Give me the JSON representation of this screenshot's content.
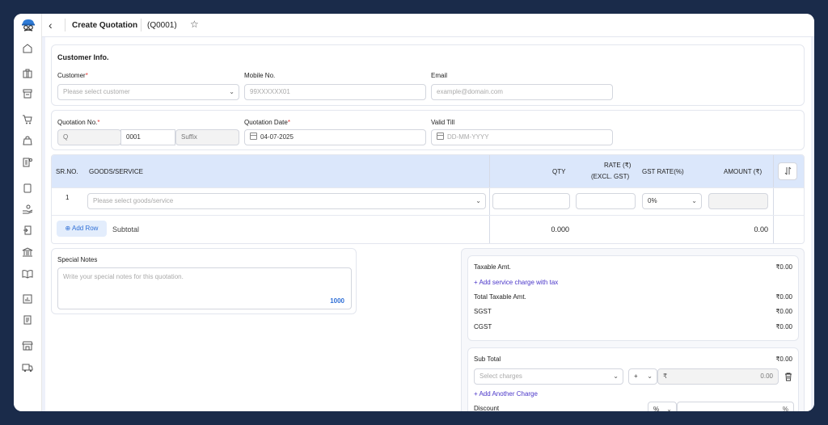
{
  "header": {
    "title": "Create Quotation",
    "code": "(Q0001)"
  },
  "customer_info": {
    "title": "Customer Info.",
    "customer": {
      "label": "Customer",
      "placeholder": "Please select customer"
    },
    "mobile": {
      "label": "Mobile No.",
      "placeholder": "99XXXXXX01"
    },
    "email": {
      "label": "Email",
      "placeholder": "example@domain.com"
    }
  },
  "quotation": {
    "number_label": "Quotation No.",
    "prefix": "Q",
    "number": "0001",
    "suffix_placeholder": "Suffix",
    "date_label": "Quotation Date",
    "date_value": "04-07-2025",
    "valid_till_label": "Valid Till",
    "valid_till_placeholder": "DD-MM-YYYY"
  },
  "table": {
    "headers": {
      "sr": "SR.NO.",
      "goods": "GOODS/SERVICE",
      "qty": "QTY",
      "rate": "RATE (₹)",
      "rate_sub": "(EXCL. GST)",
      "gst": "GST RATE(%)",
      "amount": "AMOUNT (₹)"
    },
    "rows": [
      {
        "sr": "1",
        "goods_placeholder": "Please select goods/service",
        "gst": "0%"
      }
    ],
    "add_row": "Add Row",
    "subtotal_label": "Subtotal",
    "subtotal_qty": "0.000",
    "subtotal_amount": "0.00"
  },
  "notes": {
    "label": "Special Notes",
    "placeholder": "Write your special notes for this quotation.",
    "remaining": "1000"
  },
  "summary": {
    "taxable_label": "Taxable Amt.",
    "taxable_value": "₹0.00",
    "add_service_charge": "Add service charge with tax",
    "total_taxable_label": "Total Taxable Amt.",
    "total_taxable_value": "₹0.00",
    "sgst_label": "SGST",
    "sgst_value": "₹0.00",
    "cgst_label": "CGST",
    "cgst_value": "₹0.00",
    "subtotal_label": "Sub Total",
    "subtotal_value": "₹0.00",
    "charges_placeholder": "Select charges",
    "charge_sign": "+",
    "currency_symbol": "₹",
    "charge_value": "0.00",
    "add_another_charge": "Add Another Charge",
    "discount_label": "Discount",
    "discount_type": "%",
    "discount_suffix": "%"
  },
  "sidebar_icons": [
    "home-icon",
    "briefcase-icon",
    "archive-icon",
    "cart-icon",
    "bag-icon",
    "coins-icon",
    "book-icon",
    "hand-coin-icon",
    "receipt-return-icon",
    "bank-icon",
    "open-book-icon",
    "report-icon",
    "invoice-icon",
    "store-icon",
    "truck-icon"
  ]
}
